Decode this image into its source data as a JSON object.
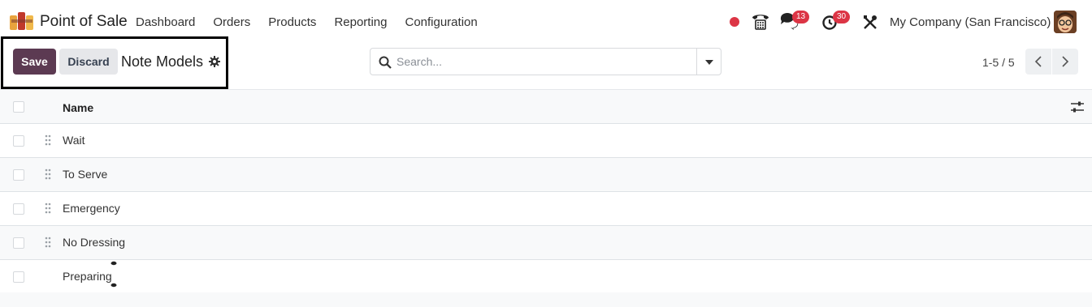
{
  "app": {
    "name": "Point of Sale"
  },
  "nav": {
    "menu": [
      "Dashboard",
      "Orders",
      "Products",
      "Reporting",
      "Configuration"
    ],
    "messages_count": "13",
    "activities_count": "30",
    "company": "My Company (San Francisco)"
  },
  "control": {
    "save_label": "Save",
    "discard_label": "Discard",
    "title": "Note Models"
  },
  "search": {
    "placeholder": "Search..."
  },
  "pager": {
    "value": "1-5 / 5"
  },
  "list": {
    "column": "Name",
    "rows": [
      "Wait",
      "To Serve",
      "Emergency",
      "No Dressing",
      "Preparing"
    ]
  },
  "colors": {
    "primary": "#5c3a52",
    "badge": "#dc3545",
    "highlight_border": "#000000"
  },
  "icons": [
    "app-logo-icon",
    "red-status-dot-icon",
    "phone-icon",
    "chat-icon",
    "activity-clock-icon",
    "tools-icon",
    "avatar",
    "gear-icon",
    "search-icon",
    "chevron-left-icon",
    "chevron-right-icon",
    "column-settings-icon",
    "drag-handle-icon"
  ]
}
